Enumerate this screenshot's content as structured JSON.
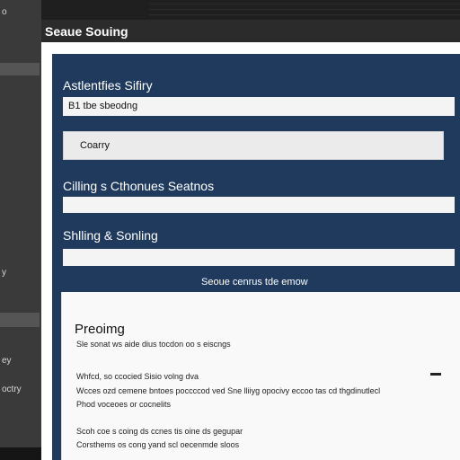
{
  "sidebar": {
    "items": [
      {
        "label": "o"
      },
      {
        "label": "y"
      },
      {
        "label": "ey"
      },
      {
        "label": "octry"
      }
    ]
  },
  "window": {
    "title": "Seaue Souing"
  },
  "form": {
    "heading1": "Astlentfies Sifiry",
    "field1_value": "B1 tbe sbeodng",
    "select_value": "Coarry",
    "heading2": "Cilling s Cthonues Seatnos",
    "heading3": "Shlling & Sonling",
    "caption": "Seoue cenrus tde emow"
  },
  "card": {
    "title": "Preoimg",
    "lines": [
      "Sle sonat ws aide dius tocdon oo s eiscngs",
      "Whfcd, so ccocied Sisio volng dva",
      "Wcces ozd cemene bntoes poccccod ved Sne lliiyg opocivy eccoo tas cd thgdinutlecl",
      "Phod voceoes or cocnelits",
      "Scoh coe s coing ds ccnes tis oine ds gegupar",
      "Corsthems os cong yand scl oecenmde sloos"
    ]
  }
}
